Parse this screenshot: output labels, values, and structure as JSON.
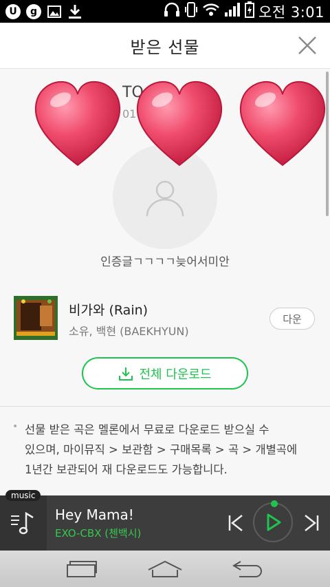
{
  "status_bar": {
    "time": "오전 3:01",
    "icons": [
      "u-plus-icon",
      "g-icon",
      "image-icon",
      "download-icon",
      "headphones-icon",
      "vibrate-icon",
      "wifi-icon",
      "signal-icon",
      "battery-icon"
    ]
  },
  "header": {
    "title": "받은 선물",
    "close_icon": "close-icon"
  },
  "gift": {
    "sender_name": "TO",
    "sender_date": "01",
    "message": "인증글ㄱㄱㄱㄱ늦어서미안",
    "decoration": "heart-stickers"
  },
  "song": {
    "title": "비가와 (Rain)",
    "artist": "소유, 백현 (BAEKHYUN)",
    "download_label": "다운"
  },
  "download_all_label": "전체 다운로드",
  "notice_lines": [
    "선물 받은 곡은 멜론에서 무료로 다운로드 받으실 수",
    "있으며, 마이뮤직 > 보관함 > 구매목록 > 곡 > 개별곡에",
    "1년간 보관되어 재 다운로드도 가능합니다."
  ],
  "player": {
    "tag": "music",
    "title": "Hey Mama!",
    "artist": "EXO-CBX (첸백시)"
  },
  "colors": {
    "accent": "#1fc44e",
    "player_bg": "#3d3d3d"
  }
}
